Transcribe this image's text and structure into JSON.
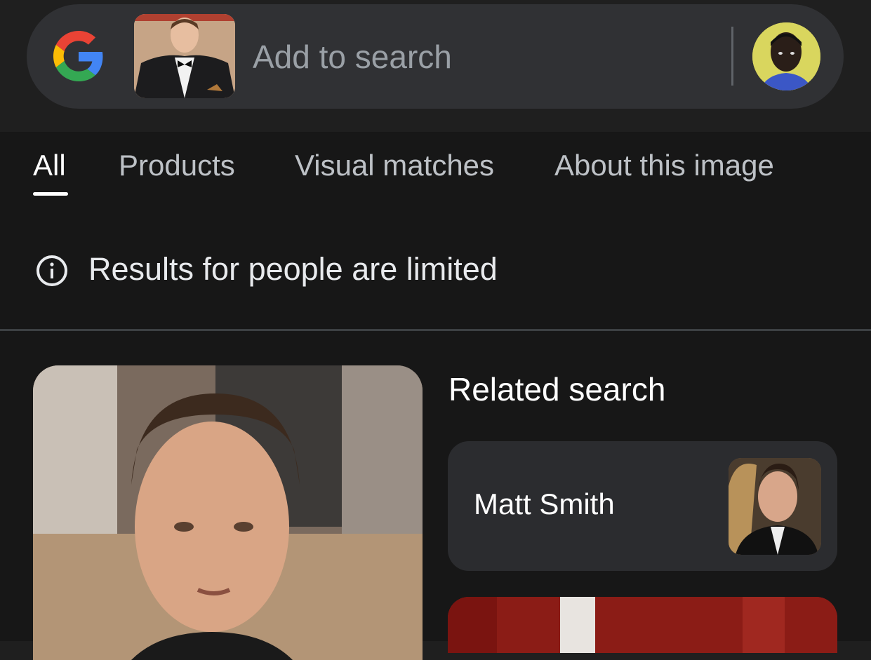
{
  "search": {
    "placeholder": "Add to search"
  },
  "tabs": [
    {
      "label": "All",
      "active": true
    },
    {
      "label": "Products",
      "active": false
    },
    {
      "label": "Visual matches",
      "active": false
    },
    {
      "label": "About this image",
      "active": false
    }
  ],
  "notice": {
    "text": "Results for people are limited",
    "icon": "info-icon"
  },
  "related": {
    "title": "Related search",
    "items": [
      {
        "label": "Matt Smith"
      }
    ]
  },
  "colors": {
    "background": "#1f1f1f",
    "searchbar": "#303134",
    "card": "#2b2c2f",
    "google_blue": "#4285F4",
    "google_red": "#EA4335",
    "google_yellow": "#FBBC05",
    "google_green": "#34A853"
  }
}
